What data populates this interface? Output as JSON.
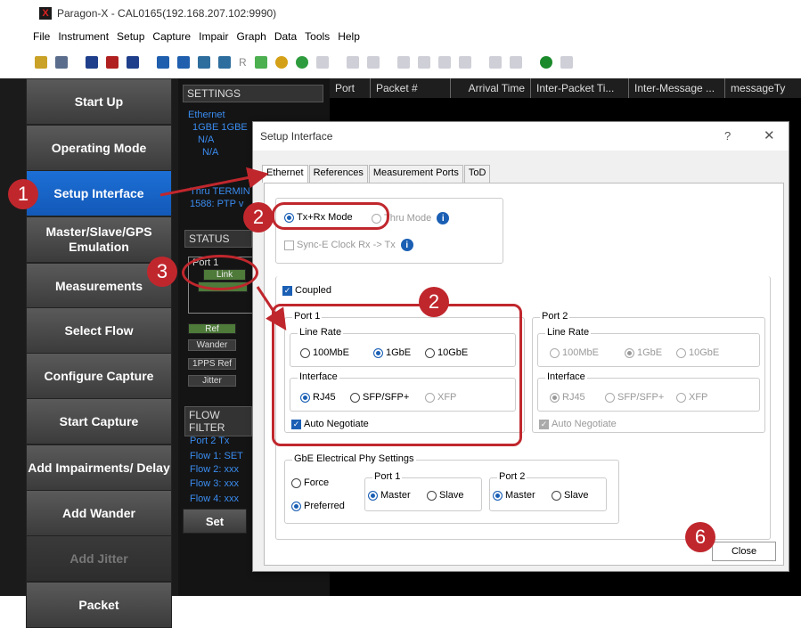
{
  "app": {
    "title": "Paragon-X - CAL0165(192.168.207.102:9990)"
  },
  "menu": [
    "File",
    "Instrument",
    "Setup",
    "Capture",
    "Impair",
    "Graph",
    "Data",
    "Tools",
    "Help"
  ],
  "toolbar": {
    "r_label": "R"
  },
  "nav": {
    "start_up": "Start Up",
    "operating_mode": "Operating Mode",
    "setup_interface": "Setup Interface",
    "master_slave": "Master/Slave/GPS Emulation",
    "measurements": "Measurements",
    "select_flow": "Select Flow",
    "configure_capture": "Configure Capture",
    "start_capture": "Start Capture",
    "add_impairments": "Add Impairments/ Delay",
    "add_wander": "Add Wander",
    "add_jitter": "Add Jitter",
    "packet": "Packet"
  },
  "settings": {
    "header": "SETTINGS",
    "lines": [
      "Ethernet",
      "1GBE  1GBE",
      "N/A",
      "N/A",
      "Thru TERMIN",
      "1588: PTP v"
    ]
  },
  "status": {
    "header": "STATUS",
    "port1": "Port 1",
    "link": "Link",
    "ref": "Ref",
    "wander": "Wander",
    "pps_ref": "1PPS Ref",
    "jitter": "Jitter"
  },
  "flow_filter": {
    "header": "FLOW FILTER",
    "lines": [
      "Port 2 Tx",
      "Flow 1: SET",
      "Flow 2: xxx",
      "Flow 3: xxx",
      "Flow 4: xxx"
    ],
    "set_button": "Set"
  },
  "grid": {
    "columns": [
      "Port",
      "Packet #",
      "Arrival Time",
      "Inter-Packet Ti...",
      "Inter-Message ...",
      "messageTy"
    ]
  },
  "dialog": {
    "title": "Setup Interface",
    "help": "?",
    "close_x": "✕",
    "tabs": [
      "Ethernet",
      "References",
      "Measurement Ports",
      "ToD"
    ],
    "mode_tx_rx": "Tx+Rx Mode",
    "mode_thru": "Thru Mode",
    "sync_e": "Sync-E Clock Rx -> Tx",
    "coupled": "Coupled",
    "port1": {
      "title": "Port 1",
      "line_rate": "Line Rate",
      "rates": [
        "100MbE",
        "1GbE",
        "10GbE"
      ],
      "interface": "Interface",
      "interfaces": [
        "RJ45",
        "SFP/SFP+",
        "XFP"
      ],
      "auto_negotiate": "Auto Negotiate"
    },
    "port2": {
      "title": "Port 2",
      "line_rate": "Line Rate",
      "rates": [
        "100MbE",
        "1GbE",
        "10GbE"
      ],
      "interface": "Interface",
      "interfaces": [
        "RJ45",
        "SFP/SFP+",
        "XFP"
      ],
      "auto_negotiate": "Auto Negotiate"
    },
    "gbe": {
      "title": "GbE Electrical Phy Settings",
      "force": "Force",
      "preferred": "Preferred",
      "port1": "Port 1",
      "port2": "Port 2",
      "master": "Master",
      "slave": "Slave"
    },
    "close_button": "Close"
  },
  "badges": [
    "1",
    "2",
    "3",
    "2",
    "6"
  ],
  "colors": {
    "accent": "#1a5fb4",
    "callout": "#c0272d"
  }
}
